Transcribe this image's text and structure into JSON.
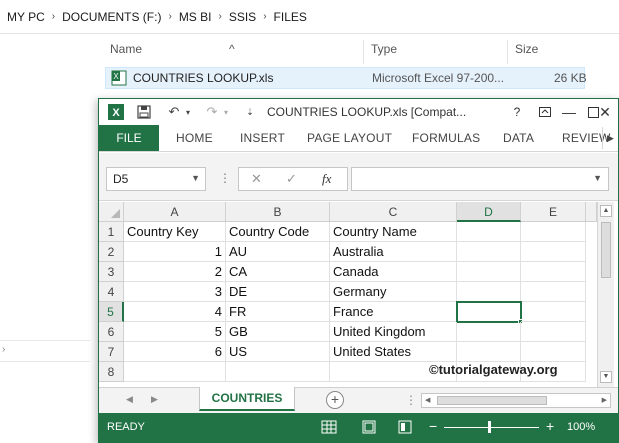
{
  "explorer": {
    "breadcrumb": [
      "MY PC",
      "DOCUMENTS (F:)",
      "MS BI",
      "SSIS",
      "FILES"
    ],
    "columns": {
      "name": "Name",
      "type": "Type",
      "size": "Size"
    },
    "file": {
      "name": "COUNTRIES LOOKUP.xls",
      "type": "Microsoft Excel 97-200...",
      "size": "26 KB"
    }
  },
  "excel": {
    "title": "COUNTRIES LOOKUP.xls  [Compat...",
    "ribbon_tabs": [
      "FILE",
      "HOME",
      "INSERT",
      "PAGE LAYOUT",
      "FORMULAS",
      "DATA",
      "REVIEW"
    ],
    "namebox": "D5",
    "fx_label": "fx",
    "column_headers": [
      "A",
      "B",
      "C",
      "D",
      "E"
    ],
    "row_headers": [
      "1",
      "2",
      "3",
      "4",
      "5",
      "6",
      "7",
      "8"
    ],
    "rows": [
      [
        "Country Key",
        "Country Code",
        "Country Name",
        "",
        ""
      ],
      [
        "1",
        "AU",
        "Australia",
        "",
        ""
      ],
      [
        "2",
        "CA",
        "Canada",
        "",
        ""
      ],
      [
        "3",
        "DE",
        "Germany",
        "",
        ""
      ],
      [
        "4",
        "FR",
        "France",
        "",
        ""
      ],
      [
        "5",
        "GB",
        "United Kingdom",
        "",
        ""
      ],
      [
        "6",
        "US",
        "United States",
        "",
        ""
      ],
      [
        "",
        "",
        "",
        "",
        ""
      ]
    ],
    "active_cell": "D5",
    "watermark": "©tutorialgateway.org",
    "sheet_tab": "COUNTRIES",
    "status": "READY",
    "zoom": "100%",
    "accent_color": "#217346"
  }
}
